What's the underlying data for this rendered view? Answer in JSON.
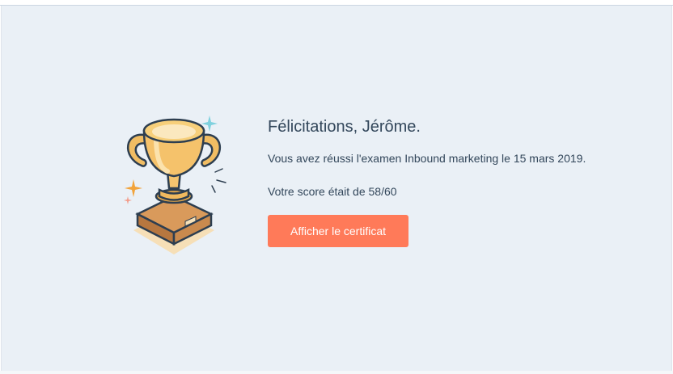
{
  "result": {
    "title": "Félicitations, Jérôme.",
    "passed_text": "Vous avez réussi l'examen Inbound marketing le 15 mars 2019.",
    "score_text": "Votre score était de 58/60",
    "certificate_button_label": "Afficher le certificat"
  },
  "icons": {
    "trophy": "trophy-illustration",
    "sparkle": "sparkle-icon"
  },
  "colors": {
    "background": "#eaf0f6",
    "text": "#33475b",
    "button": "#ff7a59",
    "button_text": "#ffffff",
    "trophy_gold": "#f5c26b",
    "sparkle_blue": "#7fd1de",
    "sparkle_orange": "#f2a33a"
  }
}
